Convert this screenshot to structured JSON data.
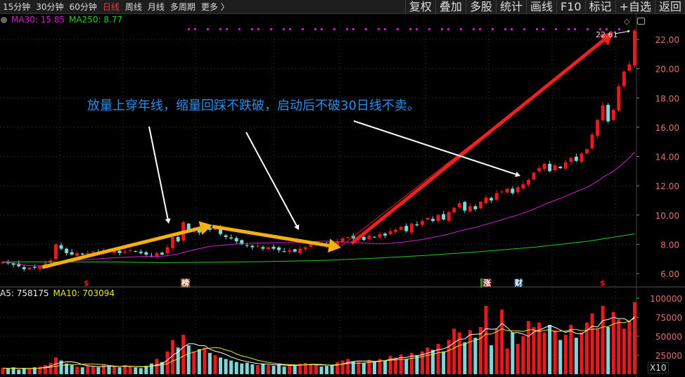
{
  "toolbar": {
    "left": [
      "15分钟",
      "30分钟",
      "60分钟",
      "日线",
      "周线",
      "月线",
      "多周期",
      "更多 〉"
    ],
    "active": "日线",
    "right": [
      "复权",
      "叠加",
      "多股",
      "统计",
      "画线",
      "F10",
      "标记",
      "+自选",
      "返回"
    ]
  },
  "legend_price": {
    "ma30": "MA30: 15.85",
    "ma250": "MA250: 8.77"
  },
  "legend_volume": {
    "ma5": "A5: 758175",
    "ma10": "MA10: 703094"
  },
  "annotation": "放量上穿年线，缩量回踩不跌破，启动后不破30日线不卖。",
  "last_price_label": "22.61",
  "markers": {
    "s1": "$",
    "bang": "榜",
    "zhang": "涨",
    "cai": "财",
    "s2": "$"
  },
  "volume_multiplier": "X10",
  "colors": {
    "up": "#e8191c",
    "down": "#7fd6d6",
    "ma30": "#d020d0",
    "ma250": "#22cc22",
    "vma5": "#ffffff",
    "vma10": "#e8e830",
    "annotation": "#2a8ee8",
    "axis": "#e07070"
  },
  "chart_data": {
    "type": "candlestick",
    "price_axis": {
      "ticks": [
        "22.00",
        "20.00",
        "18.00",
        "16.00",
        "14.00",
        "12.00",
        "10.00",
        "8.00",
        "6.00"
      ],
      "range": [
        6,
        22
      ]
    },
    "volume_axis": {
      "ticks": [
        "100000",
        "75000",
        "50000",
        "25000"
      ],
      "range": [
        0,
        100000
      ]
    },
    "close": [
      6.8,
      6.7,
      6.6,
      6.5,
      6.3,
      6.4,
      6.4,
      6.5,
      6.7,
      6.9,
      8.0,
      7.7,
      7.4,
      7.3,
      7.4,
      7.3,
      7.4,
      7.5,
      7.4,
      7.6,
      7.5,
      7.6,
      7.4,
      7.5,
      7.6,
      7.5,
      7.4,
      7.3,
      7.2,
      7.4,
      7.3,
      7.8,
      8.5,
      8.2,
      9.5,
      8.9,
      9.0,
      8.8,
      9.2,
      9.0,
      9.1,
      8.7,
      8.5,
      8.4,
      8.2,
      8.0,
      7.9,
      7.8,
      7.9,
      7.7,
      7.8,
      7.7,
      7.6,
      7.5,
      7.6,
      7.5,
      7.7,
      7.8,
      8.0,
      8.1,
      8.0,
      7.9,
      7.9,
      8.2,
      8.4,
      8.5,
      8.4,
      8.5,
      8.3,
      8.6,
      8.5,
      8.7,
      8.6,
      8.9,
      9.0,
      9.2,
      8.9,
      9.4,
      9.3,
      9.6,
      9.8,
      9.6,
      10.0,
      9.7,
      10.2,
      10.5,
      10.8,
      10.3,
      10.6,
      10.4,
      10.9,
      11.2,
      11.0,
      11.5,
      11.6,
      11.8,
      11.5,
      11.9,
      12.1,
      12.4,
      12.9,
      13.2,
      13.5,
      13.0,
      13.4,
      13.2,
      13.6,
      13.9,
      13.7,
      14.2,
      14.5,
      15.5,
      16.5,
      17.5,
      16.4,
      17.2,
      18.8,
      19.8,
      20.3,
      22.6
    ],
    "volume": [
      8000,
      7000,
      9000,
      6000,
      8000,
      7000,
      9000,
      10000,
      12000,
      15000,
      22000,
      18000,
      14000,
      12000,
      10000,
      9000,
      11000,
      10000,
      9000,
      12000,
      10000,
      11000,
      9000,
      12000,
      10000,
      9000,
      8000,
      11000,
      14000,
      20000,
      16000,
      30000,
      45000,
      35000,
      52000,
      38000,
      30000,
      33000,
      35000,
      28000,
      25000,
      22000,
      20000,
      18000,
      16000,
      14000,
      15000,
      13000,
      12000,
      14000,
      12000,
      11000,
      13000,
      10000,
      12000,
      11000,
      14000,
      15000,
      13000,
      12000,
      10000,
      11000,
      12000,
      16000,
      18000,
      20000,
      17000,
      16000,
      15000,
      19000,
      17000,
      20000,
      18000,
      24000,
      22000,
      26000,
      20000,
      28000,
      25000,
      30000,
      35000,
      32000,
      40000,
      30000,
      45000,
      60000,
      55000,
      42000,
      58000,
      48000,
      62000,
      90000,
      38000,
      60000,
      85000,
      34000,
      55000,
      40000,
      50000,
      70000,
      62000,
      68000,
      55000,
      65000,
      58000,
      45000,
      52000,
      65000,
      48000,
      55000,
      68000,
      80000,
      60000,
      90000,
      62000,
      82000,
      72000,
      60000,
      70000,
      95000
    ],
    "ma250_keypoints": [
      6.8,
      6.8,
      6.8,
      6.75,
      6.78,
      6.82,
      6.9,
      7.05,
      7.25,
      7.5,
      7.8,
      8.2,
      8.77
    ]
  }
}
